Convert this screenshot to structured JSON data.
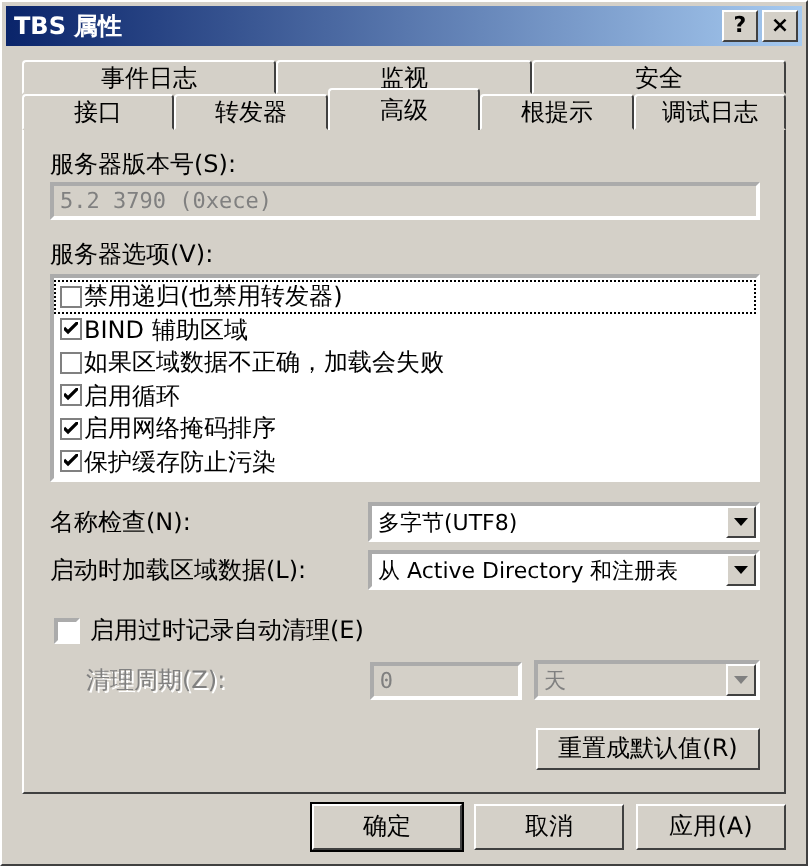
{
  "window": {
    "title": "TBS 属性"
  },
  "title_buttons": [
    "?",
    "×"
  ],
  "tab_rows": [
    [
      {
        "label": "事件日志",
        "selected": false
      },
      {
        "label": "监视",
        "selected": false
      },
      {
        "label": "安全",
        "selected": false
      }
    ],
    [
      {
        "label": "接口",
        "selected": false
      },
      {
        "label": "转发器",
        "selected": false
      },
      {
        "label": "高级",
        "selected": true
      },
      {
        "label": "根提示",
        "selected": false
      },
      {
        "label": "调试日志",
        "selected": false
      }
    ]
  ],
  "version": {
    "label": "服务器版本号(S):",
    "value": "5.2 3790 (0xece)",
    "disabled": true
  },
  "options": {
    "label": "服务器选项(V):",
    "items": [
      {
        "label": "禁用递归(也禁用转发器)",
        "checked": false,
        "focused": true
      },
      {
        "label": "BIND 辅助区域",
        "checked": true,
        "focused": false
      },
      {
        "label": "如果区域数据不正确，加载会失败",
        "checked": false,
        "focused": false
      },
      {
        "label": "启用循环",
        "checked": true,
        "focused": false
      },
      {
        "label": "启用网络掩码排序",
        "checked": true,
        "focused": false
      },
      {
        "label": "保护缓存防止污染",
        "checked": true,
        "focused": false
      }
    ]
  },
  "selects": [
    {
      "label": "名称检查(N):",
      "value": "多字节(UTF8)"
    },
    {
      "label": "启动时加载区域数据(L):",
      "value": "从 Active Directory 和注册表"
    }
  ],
  "scavenging": {
    "label": "启用过时记录自动清理(E)",
    "checked": false,
    "period_label": "清理周期(Z):",
    "period_value": "0",
    "unit": "天",
    "disabled": true
  },
  "reset_button": "重置成默认值(R)",
  "buttons": [
    {
      "label": "确定",
      "default": true
    },
    {
      "label": "取消",
      "default": false
    },
    {
      "label": "应用(A)",
      "default": false
    }
  ]
}
